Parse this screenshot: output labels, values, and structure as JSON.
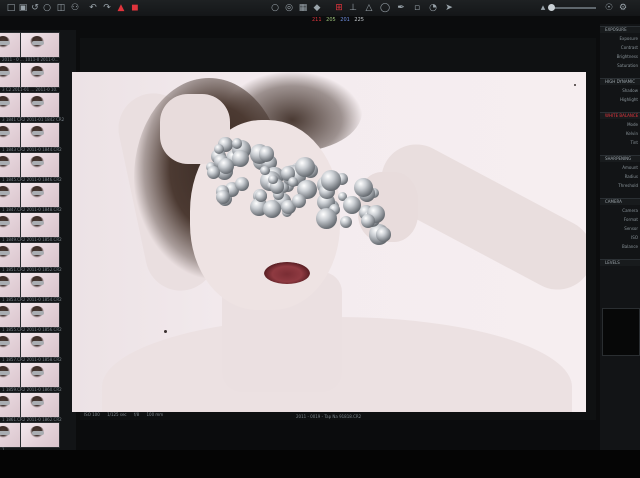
{
  "toolbar": {
    "icons": [
      "import-icon",
      "capture-icon",
      "undo-icon",
      "redo-icon",
      "tethered-icon",
      "process-icon",
      "crop-icon",
      "straighten-icon",
      "pan-icon",
      "zoom-icon",
      "picker-icon",
      "brush-icon",
      "cursor-icon",
      "spot-icon",
      "loupe-icon",
      "warning-icon"
    ],
    "accent_color": "#e0343c"
  },
  "readout": {
    "r": "211",
    "g": "205",
    "b": "201",
    "extra": "225"
  },
  "zoom_slider": {
    "level": 0.1
  },
  "filmstrip": {
    "items": [
      {
        "label": "2011 - 0  ... 1011-0  2011-0..."
      },
      {
        "label": "3 C2  2011-01 ... 2011-0 10."
      },
      {
        "label": "3  1841 CR2  2011-01  1842 CR2"
      },
      {
        "label": "1  1843 CR2  2011-0  1844.CR2"
      },
      {
        "label": "1  1845.CR2  2011-0  1846.CR2"
      },
      {
        "label": "1  1847.CR2  2011-0  1848.CR2"
      },
      {
        "label": "1  1849.CR2  2011-0  1850.CR2"
      },
      {
        "label": "1  1851.CR2  2011-0  1852.CR2"
      },
      {
        "label": "1  1853.CR2  2011-0  1854.CR2"
      },
      {
        "label": "1  1855.CR2  2011-0  1856.CR2"
      },
      {
        "label": "1  1857.CR2  2011-0  1858.CR2"
      },
      {
        "label": "1  1859.CR2  2011-0  1860.CR2"
      },
      {
        "label": "1  1861.CR2  2011-0  1862.CR2"
      },
      {
        "label": "1"
      }
    ]
  },
  "viewer": {
    "footer": {
      "iso": "ISO 100",
      "shutter": "1/125 sec",
      "aperture": "f/8",
      "focal": "100 mm",
      "filename": "2011 - 0019 - Tap Na 91818.CR2"
    }
  },
  "inspector": {
    "sections": [
      {
        "title": "EXPOSURE",
        "props": [
          "Exposure",
          "Contrast",
          "Brightness",
          "Saturation"
        ]
      },
      {
        "title": "HIGH DYNAMIC",
        "props": [
          "Shadow",
          "Highlight"
        ]
      },
      {
        "title": "WHITE BALANCE",
        "active": true,
        "props": [
          "Mode",
          "Kelvin",
          "Tint"
        ]
      },
      {
        "title": "SHARPENING",
        "props": [
          "Amount",
          "Radius",
          "Threshold"
        ]
      },
      {
        "title": "CAMERA",
        "props": [
          "Camera",
          "Format",
          "Sensor",
          "ISO",
          "Balance"
        ]
      },
      {
        "title": "LEVELS",
        "props": []
      }
    ]
  }
}
